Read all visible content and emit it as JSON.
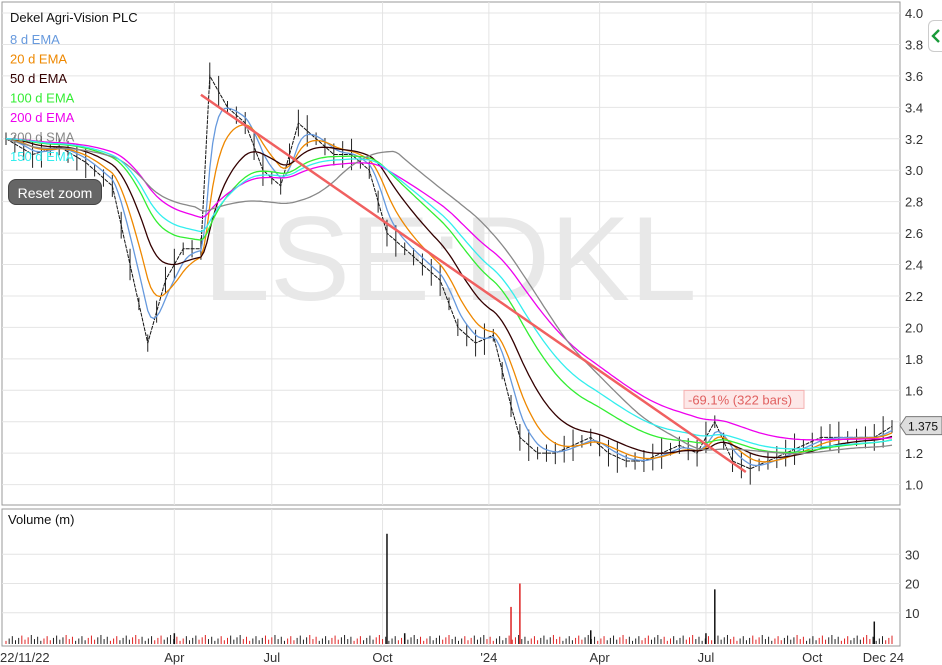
{
  "chart_data": {
    "type": "line",
    "title": "Dekel Agri-Vision PLC",
    "watermark": "LSE:DKL",
    "last_price_label": "1.375",
    "change_annotation": "-69.1% (322 bars)",
    "reset_zoom_label": "Reset zoom",
    "price_axis": {
      "ticks": [
        "1.0",
        "1.2",
        "1.4",
        "1.6",
        "1.8",
        "2.0",
        "2.2",
        "2.4",
        "2.6",
        "2.8",
        "3.0",
        "3.2",
        "3.4",
        "3.6",
        "3.8",
        "4.0"
      ],
      "ylim": [
        0.87,
        4.07
      ]
    },
    "x_axis": {
      "ticks": [
        "22/11/22",
        "Apr",
        "Jul",
        "Oct",
        "'24",
        "Apr",
        "Jul",
        "Oct",
        "Dec 24"
      ]
    },
    "volume_panel": {
      "label": "Volume (m)",
      "ticks": [
        "10",
        "20",
        "30"
      ],
      "ylim": [
        0,
        40
      ],
      "spikes": [
        {
          "t": 0.43,
          "v": 37
        },
        {
          "t": 0.58,
          "v": 20
        },
        {
          "t": 0.57,
          "v": 12
        },
        {
          "t": 0.8,
          "v": 18
        },
        {
          "t": 0.98,
          "v": 7
        },
        {
          "t": 0.79,
          "v": 3
        },
        {
          "t": 0.19,
          "v": 3
        },
        {
          "t": 0.66,
          "v": 4
        },
        {
          "t": 0.45,
          "v": 3
        }
      ]
    },
    "series": [
      {
        "name": "8 d EMA",
        "color": "#6699dd"
      },
      {
        "name": "20 d EMA",
        "color": "#ee8800"
      },
      {
        "name": "50 d EMA",
        "color": "#330000"
      },
      {
        "name": "100 d EMA",
        "color": "#33ee33"
      },
      {
        "name": "200 d EMA",
        "color": "#ee00ee"
      },
      {
        "name": "200 d SMA",
        "color": "#888888"
      },
      {
        "name": "150 d EMA",
        "color": "#33eeee"
      }
    ],
    "price": {
      "t": [
        0.0,
        0.03,
        0.06,
        0.09,
        0.12,
        0.14,
        0.16,
        0.18,
        0.2,
        0.22,
        0.23,
        0.25,
        0.27,
        0.29,
        0.31,
        0.33,
        0.35,
        0.37,
        0.39,
        0.41,
        0.43,
        0.45,
        0.47,
        0.49,
        0.51,
        0.53,
        0.55,
        0.57,
        0.58,
        0.6,
        0.62,
        0.64,
        0.66,
        0.68,
        0.7,
        0.72,
        0.74,
        0.76,
        0.78,
        0.8,
        0.82,
        0.84,
        0.86,
        0.88,
        0.9,
        0.92,
        0.94,
        0.96,
        0.98,
        1.0
      ],
      "close": [
        3.2,
        3.1,
        3.15,
        3.05,
        2.9,
        2.4,
        1.9,
        2.3,
        2.5,
        2.5,
        3.6,
        3.4,
        3.3,
        3.0,
        2.9,
        3.3,
        3.2,
        3.1,
        3.1,
        3.0,
        2.6,
        2.5,
        2.4,
        2.3,
        2.0,
        1.9,
        1.95,
        1.5,
        1.3,
        1.2,
        1.2,
        1.25,
        1.3,
        1.2,
        1.15,
        1.15,
        1.2,
        1.25,
        1.2,
        1.4,
        1.15,
        1.1,
        1.15,
        1.2,
        1.25,
        1.3,
        1.3,
        1.3,
        1.3,
        1.37
      ]
    },
    "trendline": {
      "from": {
        "t": 0.22,
        "v": 3.48
      },
      "to": {
        "t": 0.835,
        "v": 1.08
      }
    }
  }
}
